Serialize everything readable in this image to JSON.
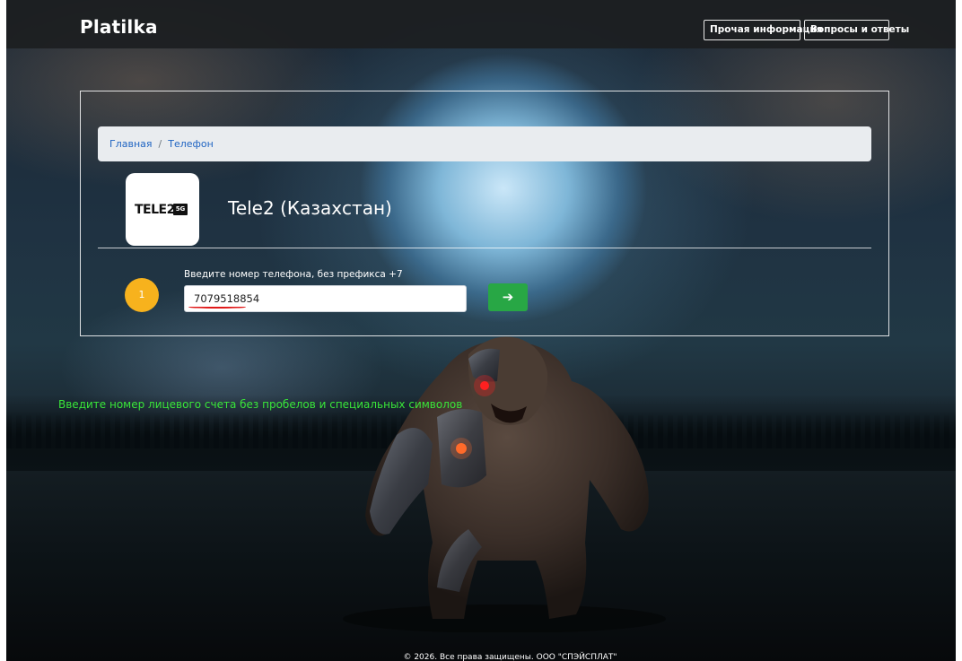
{
  "header": {
    "brand": "Platilka",
    "nav": [
      {
        "label": "Прочая информация"
      },
      {
        "label": "Вопросы и ответы"
      }
    ]
  },
  "breadcrumb": {
    "home": "Главная",
    "separator": "/",
    "current": "Телефон"
  },
  "operator": {
    "logo_text": "TELE2",
    "logo_badge": "5G",
    "title": "Tele2 (Казахстан)"
  },
  "form": {
    "step_number": "1",
    "phone_label": "Введите номер телефона, без префикса +7",
    "phone_value": "7079518854",
    "submit_icon": "arrow-right-icon",
    "submit_glyph": "➔"
  },
  "hint": "Введите номер лицевого счета без пробелов и специальных символов",
  "footer": "© 2026. Все права защищены. ООО \"СПЭЙСПЛАТ\"",
  "colors": {
    "header_bg": "#1c1e21",
    "accent_green": "#28a745",
    "step_badge": "#f7b21d",
    "hint_text": "#39e639",
    "link": "#1f64c2"
  }
}
